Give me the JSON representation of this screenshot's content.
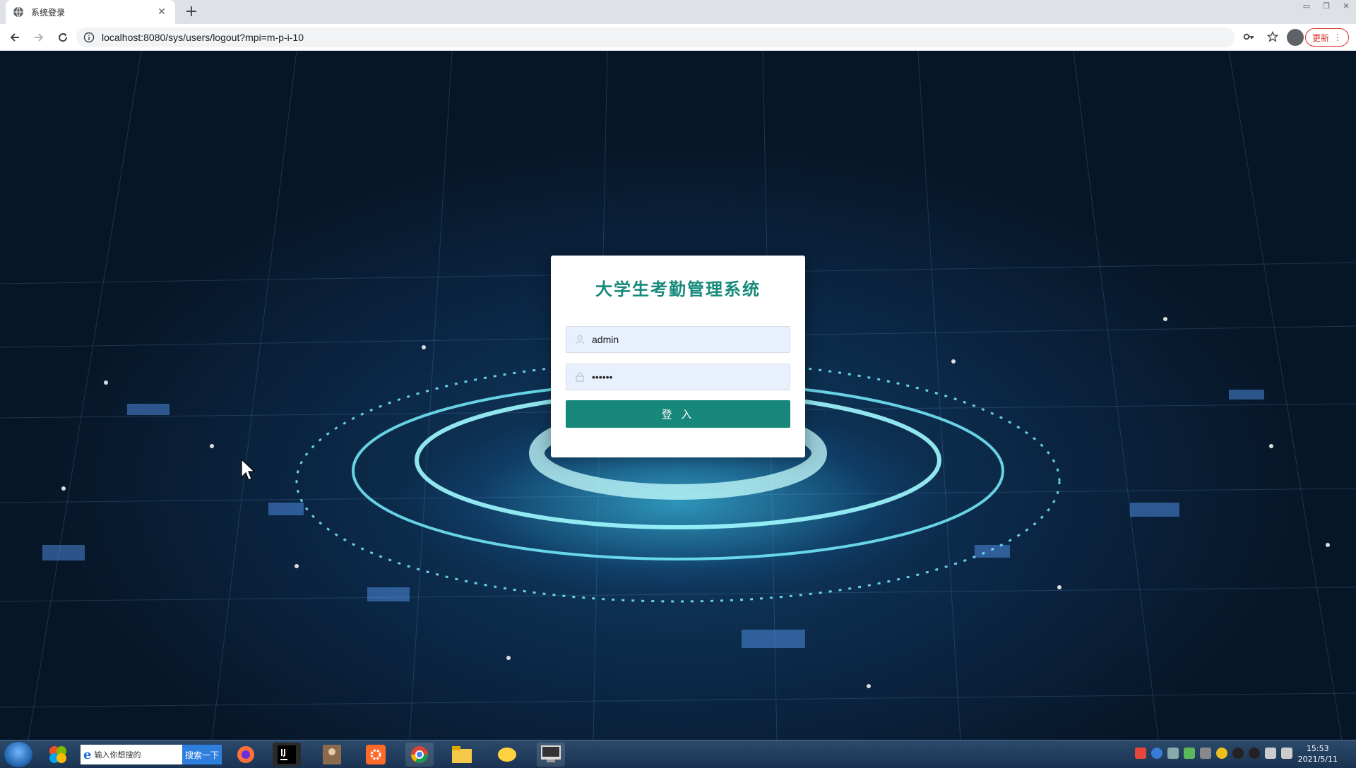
{
  "browser": {
    "tab_title": "系统登录",
    "url": "localhost:8080/sys/users/logout?mpi=m-p-i-10",
    "update_label": "更新"
  },
  "login": {
    "title": "大学生考勤管理系统",
    "username_value": "admin",
    "password_value": "••••••",
    "login_button": "登 入"
  },
  "taskbar": {
    "search_placeholder": "输入你想搜的",
    "search_button": "搜索一下",
    "time": "15:53",
    "date": "2021/5/11"
  },
  "colors": {
    "accent": "#16877a",
    "title": "#16897a",
    "input_bg": "#e8f0fe"
  }
}
